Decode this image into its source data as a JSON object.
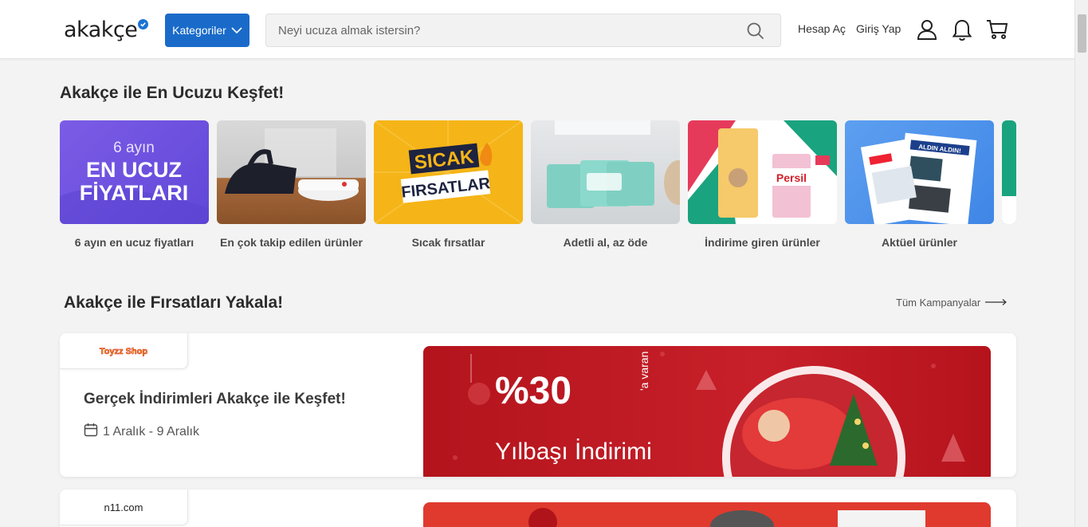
{
  "header": {
    "logo_text": "akakçe",
    "categories_label": "Kategoriler",
    "search_placeholder": "Neyi ucuza almak istersin?",
    "signup_label": "Hesap Aç",
    "login_label": "Giriş Yap",
    "brand_color": "#1a6bc9"
  },
  "discover": {
    "title": "Akakçe ile En Ucuzu Keşfet!",
    "tiles": [
      {
        "label": "6 ayın en ucuz fiyatları",
        "image_line1": "6 ayın",
        "image_line2": "EN UCUZ",
        "image_line3": "FİYATLARI"
      },
      {
        "label": "En çok takip edilen ürünler"
      },
      {
        "label": "Sıcak fırsatlar",
        "image_line1": "SICAK",
        "image_line2": "FIRSATLAR"
      },
      {
        "label": "Adetli al, az öde"
      },
      {
        "label": "İndirime giren ürünler",
        "image_line1": "Persil"
      },
      {
        "label": "Aktüel ürünler",
        "image_line1": "ALDIN ALDIN!"
      }
    ]
  },
  "deals": {
    "title": "Akakçe ile Fırsatları Yakala!",
    "all_campaigns_label": "Tüm Kampanyalar",
    "cards": [
      {
        "store": "Toyzz Shop",
        "title": "Gerçek İndirimleri Akakçe ile Keşfet!",
        "date": "1 Aralık - 9 Aralık",
        "banner_percent": "%30",
        "banner_suffix": "'a varan",
        "banner_text": "Yılbaşı İndirimi"
      },
      {
        "store": "n11.com"
      }
    ]
  }
}
